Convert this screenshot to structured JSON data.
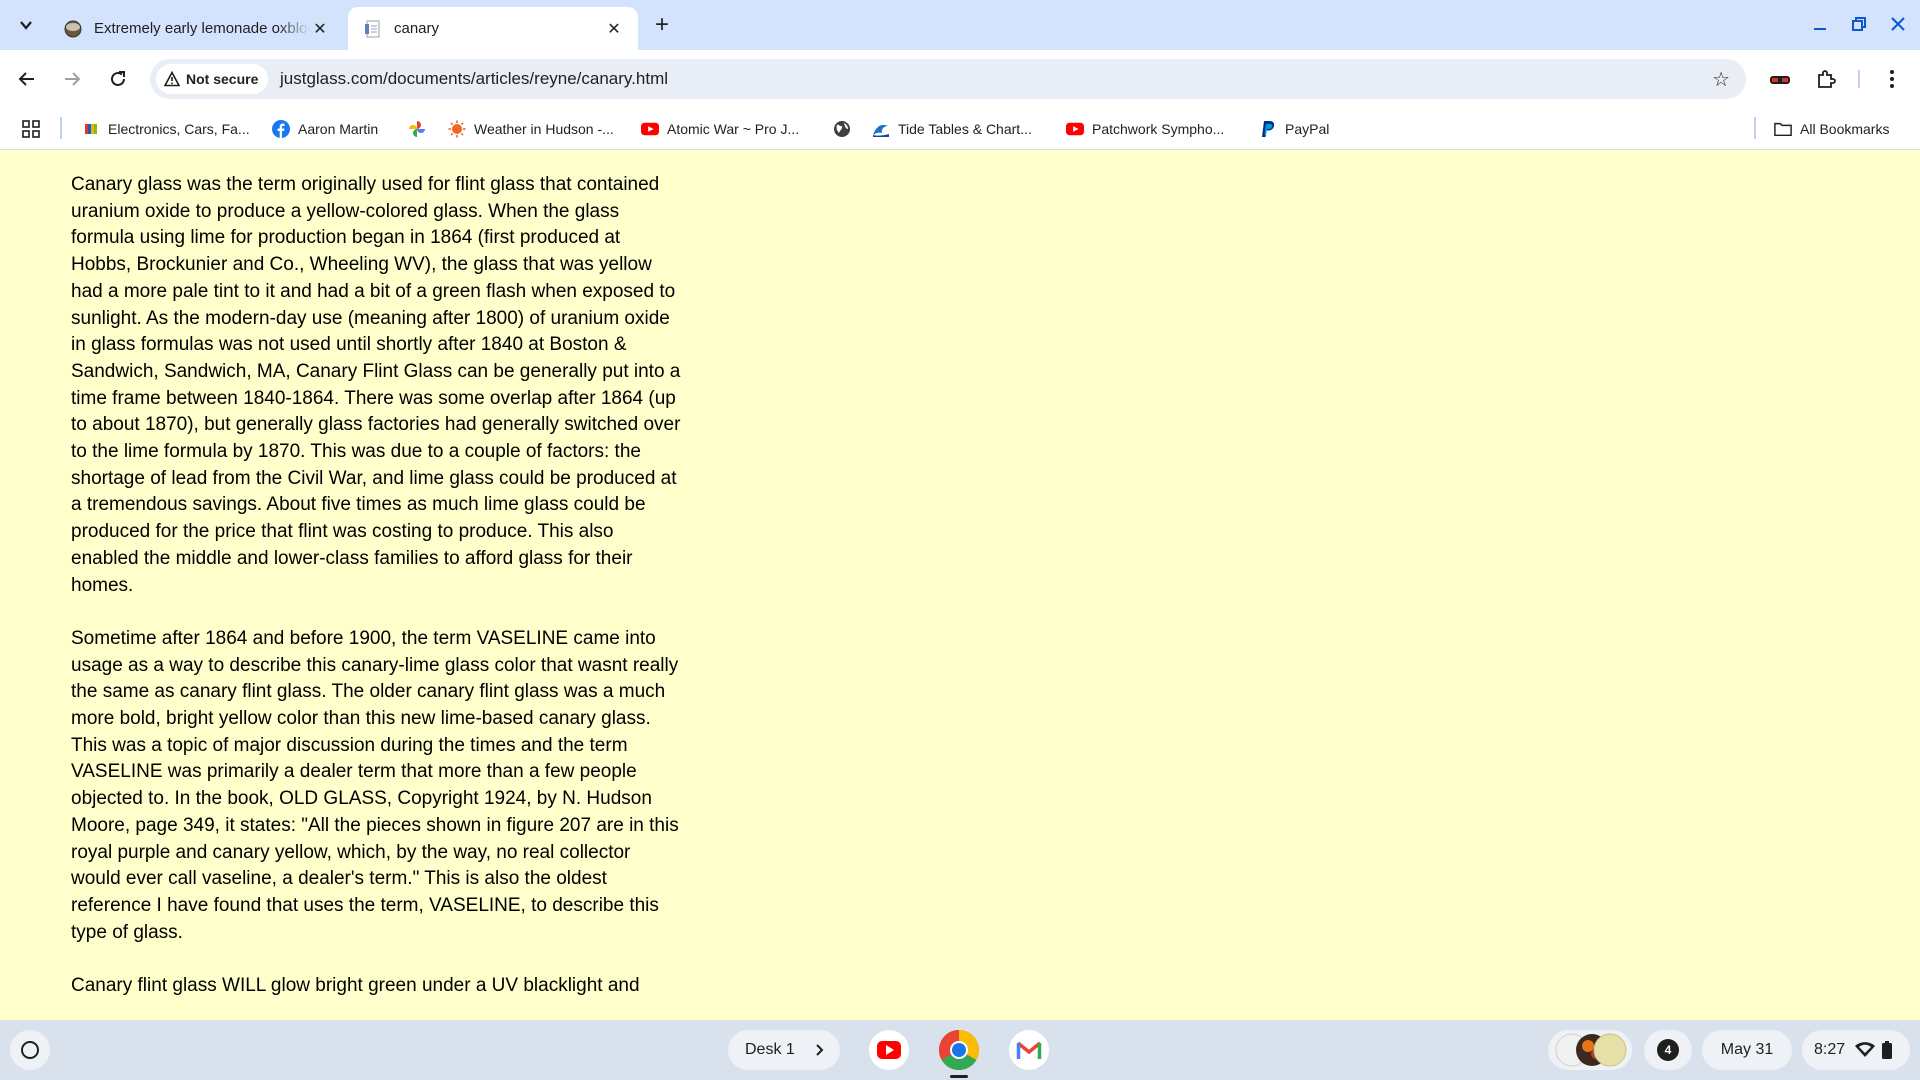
{
  "browser": {
    "tabs": [
      {
        "title": "Extremely early lemonade oxblood",
        "active": false
      },
      {
        "title": "canary",
        "active": true
      }
    ],
    "address": {
      "security_label": "Not secure",
      "url": "justglass.com/documents/articles/reyne/canary.html"
    },
    "bookmarks": [
      {
        "label": "Electronics, Cars, Fa...",
        "icon": "ebay-icon"
      },
      {
        "label": "Aaron Martin",
        "icon": "facebook-icon"
      },
      {
        "label": "",
        "icon": "pinwheel-icon"
      },
      {
        "label": "Weather in Hudson -...",
        "icon": "weather-icon"
      },
      {
        "label": "Atomic War ~ Pro J...",
        "icon": "youtube-icon"
      },
      {
        "label": "",
        "icon": "globe-icon"
      },
      {
        "label": "Tide Tables & Chart...",
        "icon": "wave-icon"
      },
      {
        "label": "Patchwork Sympho...",
        "icon": "youtube-icon"
      },
      {
        "label": "PayPal",
        "icon": "paypal-icon"
      }
    ],
    "all_bookmarks_label": "All Bookmarks"
  },
  "article": {
    "paragraphs": [
      "Canary glass was the term originally used for flint glass that contained uranium oxide to produce a yellow-colored glass.  When the glass formula using lime for production  began in 1864 (first produced at Hobbs, Brockunier and Co., Wheeling WV), the glass that was yellow had a more pale tint to it and had a bit of a green flash when exposed to sunlight.  As the modern-day use (meaning after 1800) of uranium oxide in glass formulas was not used until shortly after 1840 at Boston & Sandwich, Sandwich, MA, Canary Flint Glass can be generally put into a time frame between 1840-1864.  There was some overlap after 1864 (up to about 1870), but generally glass factories had generally switched over to the lime formula by 1870.  This was due to a couple of factors:  the shortage of lead from the Civil War, and lime glass could be produced at a tremendous savings. About five times as much lime glass could be produced for the price that flint was costing to produce.  This also enabled the middle and lower-class families to afford glass for their homes.",
      "Sometime after 1864 and before 1900, the term VASELINE came into usage as a way to describe this canary-lime glass color that wasnt really the same as canary flint  glass. The older canary flint glass was a much more bold, bright yellow color than this new lime-based canary glass.   This was a topic of major discussion during the times and the term VASELINE was primarily a dealer term that more than a few people objected to.  In the book, OLD GLASS, Copyright 1924, by N. Hudson Moore, page 349, it states: \"All the pieces shown in figure 207 are in this royal purple and canary yellow, which, by the way, no real collector would ever call vaseline, a dealer's term.\"   This is also the oldest reference I have found that uses the term, VASELINE, to describe this type of glass.",
      "Canary flint glass WILL glow bright green under a UV blacklight and"
    ]
  },
  "shelf": {
    "desk_label": "Desk 1",
    "notification_count": "4",
    "date": "May 31",
    "time": "8:27"
  },
  "colors": {
    "page_background": "#ffffcc",
    "tabstrip": "#d3e3fd",
    "accent": "#0b57d0",
    "shelf": "#d8e1ec"
  }
}
